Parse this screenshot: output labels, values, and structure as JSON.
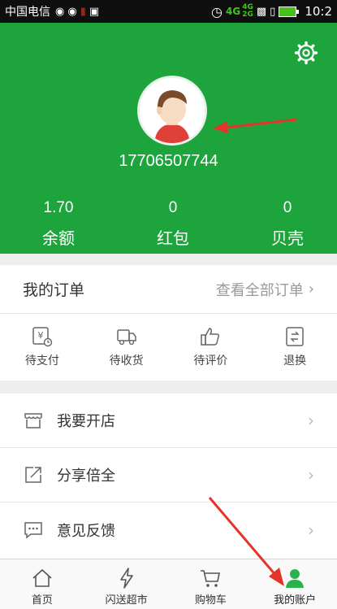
{
  "status_bar": {
    "carrier": "中国电信",
    "network_4g_top": "4G",
    "network_4g_bottom": "2G",
    "network_4g_secondary": "4G",
    "time": "10:2"
  },
  "profile": {
    "phone": "17706507744",
    "stats": [
      {
        "value": "1.70",
        "label": "余额"
      },
      {
        "value": "0",
        "label": "红包"
      },
      {
        "value": "0",
        "label": "贝壳"
      }
    ]
  },
  "orders": {
    "title": "我的订单",
    "view_all": "查看全部订单",
    "items": [
      {
        "label": "待支付",
        "icon": "pending-payment-icon"
      },
      {
        "label": "待收货",
        "icon": "delivery-truck-icon"
      },
      {
        "label": "待评价",
        "icon": "thumbs-up-icon"
      },
      {
        "label": "退换",
        "icon": "return-exchange-icon"
      }
    ]
  },
  "menu": [
    {
      "label": "我要开店",
      "icon": "open-store-icon"
    },
    {
      "label": "分享倍全",
      "icon": "share-icon"
    },
    {
      "label": "意见反馈",
      "icon": "feedback-icon"
    }
  ],
  "tabbar": [
    {
      "label": "首页",
      "icon": "home-icon"
    },
    {
      "label": "闪送超市",
      "icon": "lightning-icon"
    },
    {
      "label": "购物车",
      "icon": "cart-icon"
    },
    {
      "label": "我的账户",
      "icon": "account-icon",
      "active": true
    }
  ],
  "colors": {
    "brand_green": "#1ea43c",
    "annotation_red": "#e5332a"
  }
}
